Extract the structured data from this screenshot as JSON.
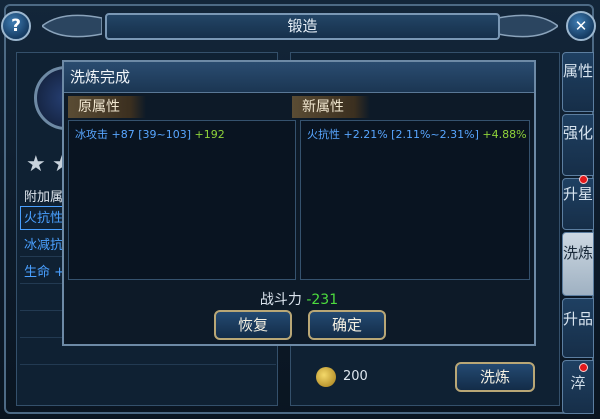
{
  "window": {
    "title": "锻造"
  },
  "buttons": {
    "help": "?",
    "close": "✕"
  },
  "background": {
    "stars": [
      "★",
      "★"
    ],
    "section_label": "附加属",
    "rows": [
      "火抗性",
      "冰减抗",
      "生命 +"
    ]
  },
  "side_tabs": [
    {
      "label": "属性",
      "active": false,
      "badge": false
    },
    {
      "label": "强化",
      "active": false,
      "badge": false
    },
    {
      "label": "升星",
      "active": false,
      "badge": true
    },
    {
      "label": "洗炼",
      "active": true,
      "badge": false
    },
    {
      "label": "升品",
      "active": false,
      "badge": false
    },
    {
      "label": "淬",
      "active": false,
      "badge": true
    }
  ],
  "cost": {
    "value": "200"
  },
  "wash_button": "洗炼",
  "dialog": {
    "title": "洗炼完成",
    "old_label": "原属性",
    "new_label": "新属性",
    "old_attr": {
      "name": "冰攻击 +87",
      "range": "[39~103]",
      "delta": "+192"
    },
    "new_attr": {
      "name": "火抗性 +2.21%",
      "range": "[2.11%~2.31%]",
      "delta": "+4.88%"
    },
    "power_label": "战斗力",
    "power_value": "-231",
    "restore_button": "恢复",
    "confirm_button": "确定"
  },
  "colors": {
    "accent_blue": "#58a6ff",
    "positive_green": "#8fd33a",
    "power_green": "#4ddc3e",
    "badge_red": "#e2181b"
  }
}
